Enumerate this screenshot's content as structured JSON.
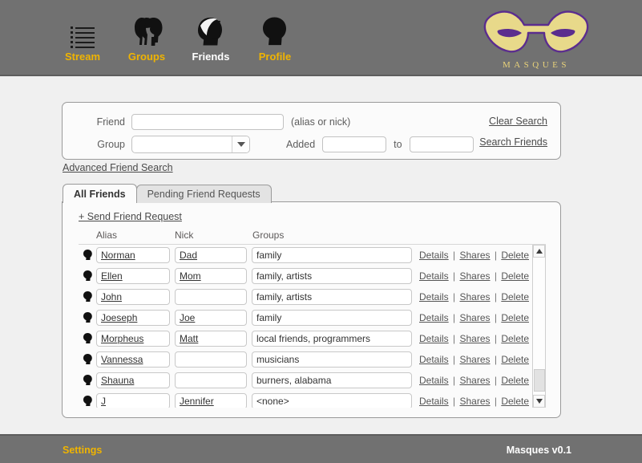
{
  "header": {
    "nav": [
      {
        "label": "Stream",
        "icon": "stream-list-icon",
        "current": false
      },
      {
        "label": "Groups",
        "icon": "groups-heads-icon",
        "current": false
      },
      {
        "label": "Friends",
        "icon": "friends-heads-icon",
        "current": true
      },
      {
        "label": "Profile",
        "icon": "profile-head-icon",
        "current": false
      }
    ],
    "logo": {
      "wordmark": "MASQUES",
      "icon": "masque-mask-icon",
      "fill": "#e8d98a",
      "stroke": "#5b2d8e"
    },
    "nav_link_color": "#f0b400",
    "bar_color": "#717171"
  },
  "search": {
    "friend_label": "Friend",
    "friend_value": "",
    "friend_hint": "(alias or nick)",
    "group_label": "Group",
    "group_value": "",
    "added_label": "Added",
    "added_from": "",
    "to_label": "to",
    "added_to": "",
    "clear_label": "Clear Search",
    "search_label": "Search Friends",
    "advanced_label": "Advanced Friend Search"
  },
  "tabs": [
    {
      "label": "All Friends",
      "active": true
    },
    {
      "label": "Pending Friend Requests",
      "active": false
    }
  ],
  "panel": {
    "send_request_label": "+ Send Friend Request",
    "columns": [
      "Alias",
      "Nick",
      "Groups"
    ],
    "actions": {
      "details": "Details",
      "shares": "Shares",
      "delete": "Delete",
      "separator": "|"
    },
    "rows": [
      {
        "alias": "Norman",
        "nick": "Dad",
        "groups": "family"
      },
      {
        "alias": "Ellen",
        "nick": "Mom",
        "groups": "family, artists"
      },
      {
        "alias": "John",
        "nick": "",
        "groups": "family, artists"
      },
      {
        "alias": "Joeseph",
        "nick": "Joe",
        "groups": "family"
      },
      {
        "alias": "Morpheus",
        "nick": "Matt",
        "groups": "local friends, programmers"
      },
      {
        "alias": "Vannessa",
        "nick": "",
        "groups": "musicians"
      },
      {
        "alias": "Shauna",
        "nick": "",
        "groups": "burners, alabama"
      },
      {
        "alias": "J",
        "nick": "Jennifer",
        "groups": "<none>"
      }
    ]
  },
  "footer": {
    "settings_label": "Settings",
    "version_label": "Masques v0.1"
  }
}
